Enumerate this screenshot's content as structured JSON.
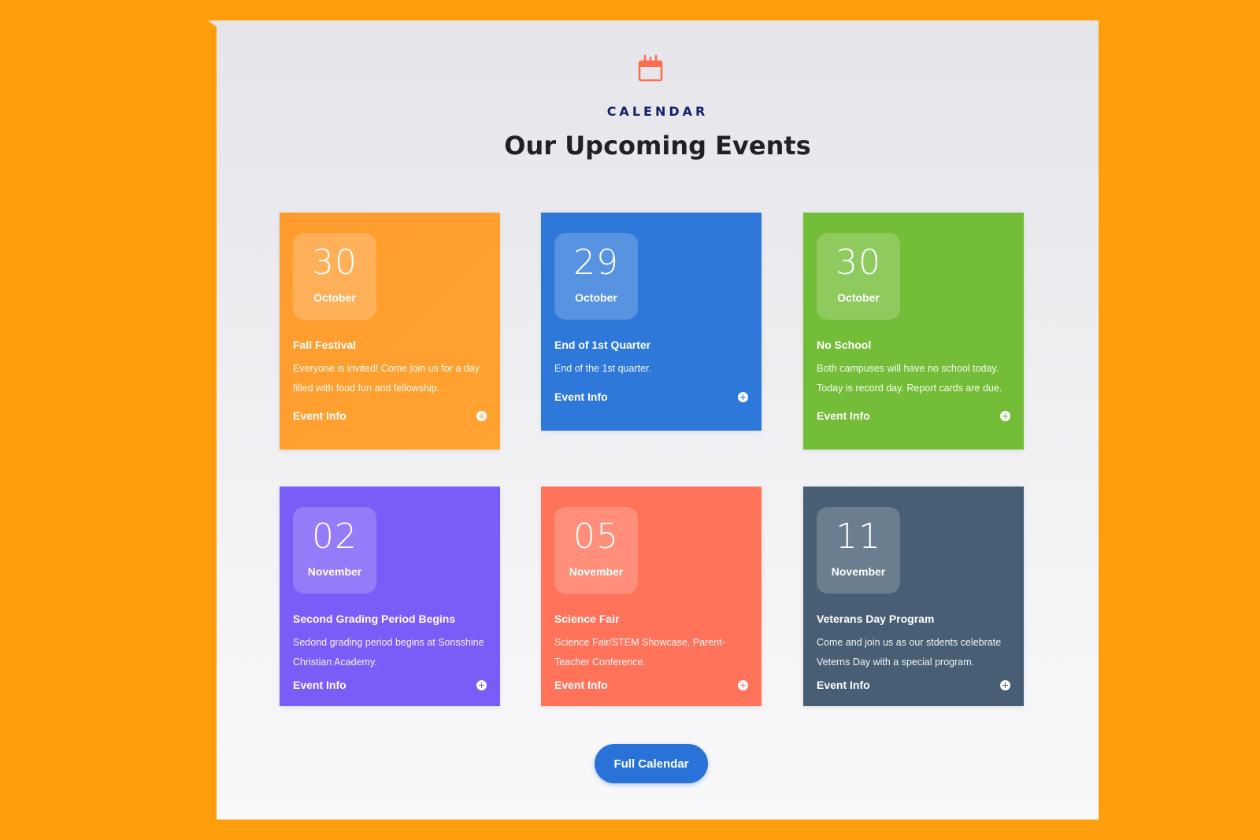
{
  "section": {
    "eyebrow": "CALENDAR",
    "heading": "Our Upcoming Events",
    "icon": "calendar-icon"
  },
  "events": [
    {
      "day": "30",
      "month": "October",
      "title": "Fall Festival",
      "description": "Everyone is invited! Come join us for a day filled with food fun and fellowship.",
      "link_label": "Event Info",
      "color": "#ff9b2e"
    },
    {
      "day": "29",
      "month": "October",
      "title": "End of 1st Quarter",
      "description": "End of the 1st quarter.",
      "link_label": "Event Info",
      "color": "#2d78d9"
    },
    {
      "day": "30",
      "month": "October",
      "title": "No School",
      "description": "Both campuses will have no school today. Today is record day. Report cards are due.",
      "link_label": "Event Info",
      "color": "#74bd38"
    },
    {
      "day": "02",
      "month": "November",
      "title": "Second Grading Period Begins",
      "description": "Sedond grading period begins at Sonsshine Christian Academy.",
      "link_label": "Event Info",
      "color": "#7a5cf7"
    },
    {
      "day": "05",
      "month": "November",
      "title": "Science Fair",
      "description": "Science Fair/STEM Showcase, Parent-Teacher Conference.",
      "link_label": "Event Info",
      "color": "#ff735a"
    },
    {
      "day": "11",
      "month": "November",
      "title": "Veterans Day Program",
      "description": "Come and join us as our stdents celebrate Veterns Day with a special program.",
      "link_label": "Event Info",
      "color": "#475e74"
    }
  ],
  "cta": {
    "label": "Full Calendar"
  },
  "colors": {
    "page_background": "#ff9e0c",
    "eyebrow": "#14206b",
    "heading": "#1f2127",
    "button": "#2a72d8"
  }
}
